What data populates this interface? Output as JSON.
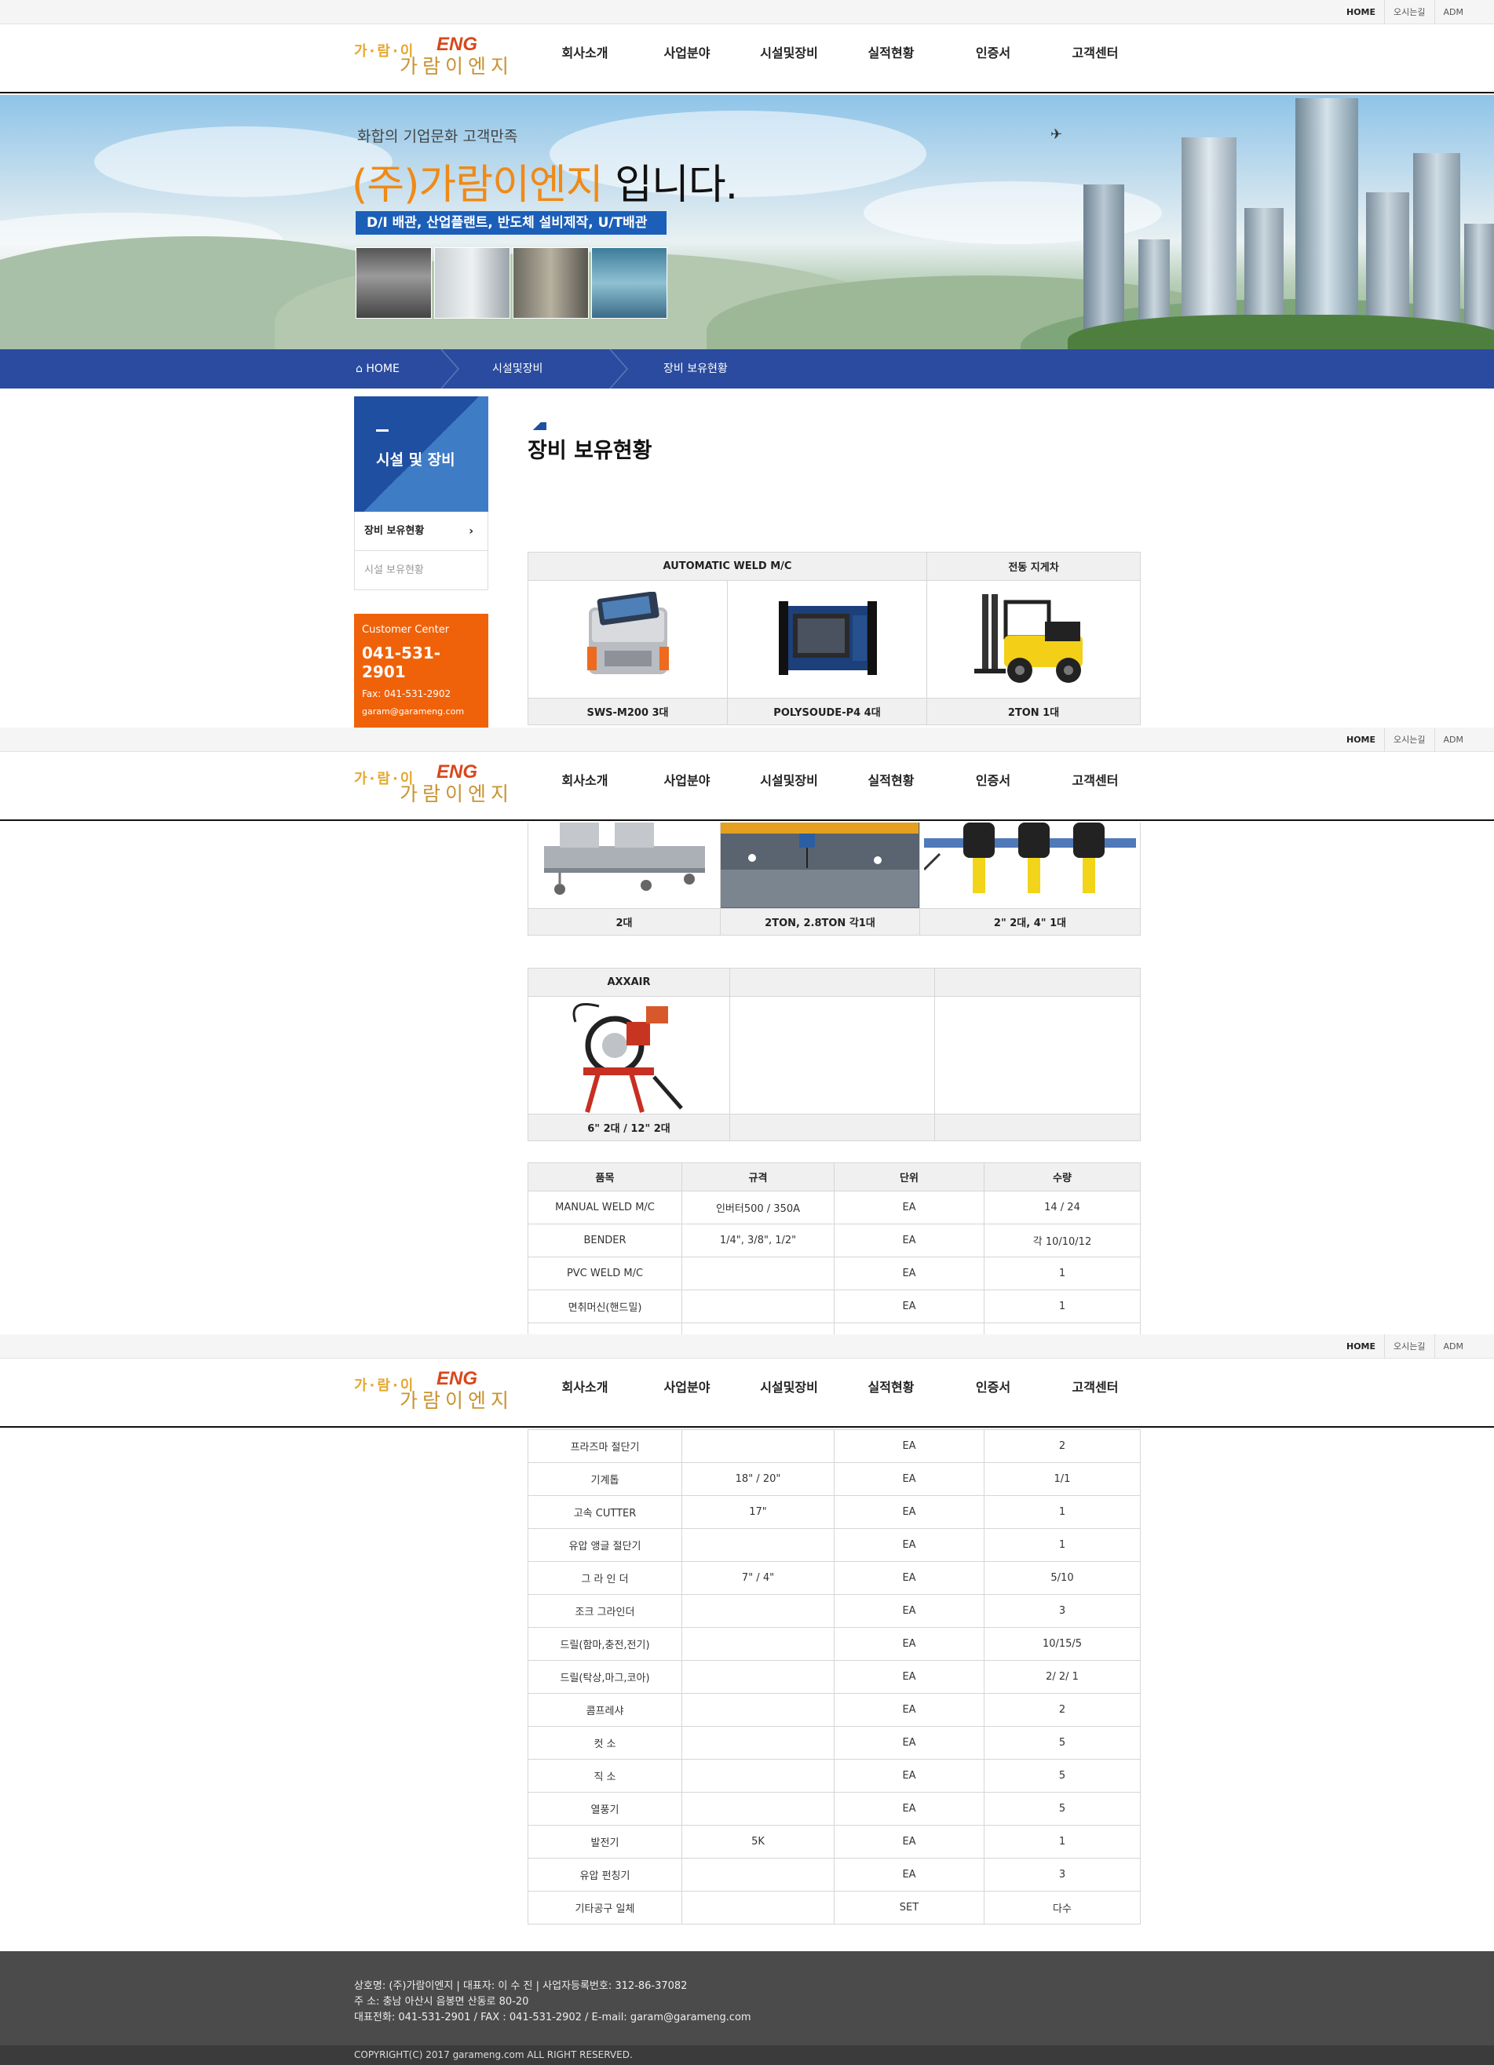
{
  "top_links": [
    "HOME",
    "오시는길",
    "ADM"
  ],
  "logo": {
    "dots": "가·람·이",
    "eng": "ENG",
    "ko": "가람이엔지"
  },
  "nav": [
    "회사소개",
    "사업분야",
    "시설및장비",
    "실적현황",
    "인증서",
    "고객센터"
  ],
  "hero": {
    "subtitle": "화합의 기업문화 고객만족",
    "title_org": "(주)가람이엔지",
    "title_rest": " 입니다.",
    "tagline": "D/I 배관, 산업플랜트, 반도체 설비제작, U/T배관"
  },
  "breadcrumb": [
    "HOME",
    "시설및장비",
    "장비 보유현황"
  ],
  "lnb": {
    "title": "시설 및 장비",
    "items": [
      {
        "label": "장비 보유현황",
        "active": true
      },
      {
        "label": "시설 보유현황",
        "active": false
      }
    ]
  },
  "customer_center": {
    "label": "Customer Center",
    "phone": "041-531-2901",
    "fax": "Fax: 041-531-2902",
    "email": "garam@garameng.com"
  },
  "page_title": "장비 보유현황",
  "equip_table1": {
    "headers": [
      "AUTOMATIC WELD M/C",
      "전동 지게차"
    ],
    "captions": [
      "SWS-M200 3대",
      "POLYSOUDE-P4 4대",
      "2TON 1대"
    ]
  },
  "equip_table2": {
    "captions": [
      "2대",
      "2TON, 2.8TON 각1대",
      "2\" 2대, 4\" 1대"
    ]
  },
  "equip_table3": {
    "headers": [
      "AXXAIR",
      "",
      ""
    ],
    "captions": [
      "6\" 2대  /  12\" 2대",
      "",
      ""
    ]
  },
  "list_table": {
    "headers": [
      "품목",
      "규격",
      "단위",
      "수량"
    ],
    "rows_a": [
      [
        "MANUAL WELD M/C",
        "인버터500 / 350A",
        "EA",
        "14 / 24"
      ],
      [
        "BENDER",
        "1/4\", 3/8\", 1/2\"",
        "EA",
        "각 10/10/12"
      ],
      [
        "PVC WELD M/C",
        "",
        "EA",
        "1"
      ],
      [
        "면취머신(핸드밀)",
        "",
        "EA",
        "1"
      ]
    ],
    "rows_b": [
      [
        "프라즈마 절단기",
        "",
        "EA",
        "2"
      ],
      [
        "기계톱",
        "18\" / 20\"",
        "EA",
        "1/1"
      ],
      [
        "고속 CUTTER",
        "17\"",
        "EA",
        "1"
      ],
      [
        "유압 앵글 절단기",
        "",
        "EA",
        "1"
      ],
      [
        "그 라 인 더",
        "7\" / 4\"",
        "EA",
        "5/10"
      ],
      [
        "조크 그라인더",
        "",
        "EA",
        "3"
      ],
      [
        "드릴(함마,충전,전기)",
        "",
        "EA",
        "10/15/5"
      ],
      [
        "드릴(탁상,마그,코아)",
        "",
        "EA",
        "2/ 2/ 1"
      ],
      [
        "콤프레샤",
        "",
        "EA",
        "2"
      ],
      [
        "컷 소",
        "",
        "EA",
        "5"
      ],
      [
        "직 소",
        "",
        "EA",
        "5"
      ],
      [
        "열풍기",
        "",
        "EA",
        "5"
      ],
      [
        "발전기",
        "5K",
        "EA",
        "1"
      ],
      [
        "유압 펀칭기",
        "",
        "EA",
        "3"
      ],
      [
        "기타공구 일체",
        "",
        "SET",
        "다수"
      ]
    ]
  },
  "footer": {
    "line1": "상호명: (주)가람이엔지   |  대표자: 이 수 진   |  사업자등록번호: 312-86-37082",
    "line2": "주   소: 충남 아산시 음봉면 산동로 80-20",
    "line3": "대표전화: 041-531-2901 / FAX : 041-531-2902 / E-mail: garam@garameng.com",
    "copyright": "COPYRIGHT(C) 2017 garameng.com ALL RIGHT RESERVED."
  },
  "colors": {
    "brand_blue": "#2a4b9f",
    "accent_orange": "#f0620a",
    "title_orange": "#f08a16",
    "footer_gray": "#4b4b4b"
  }
}
